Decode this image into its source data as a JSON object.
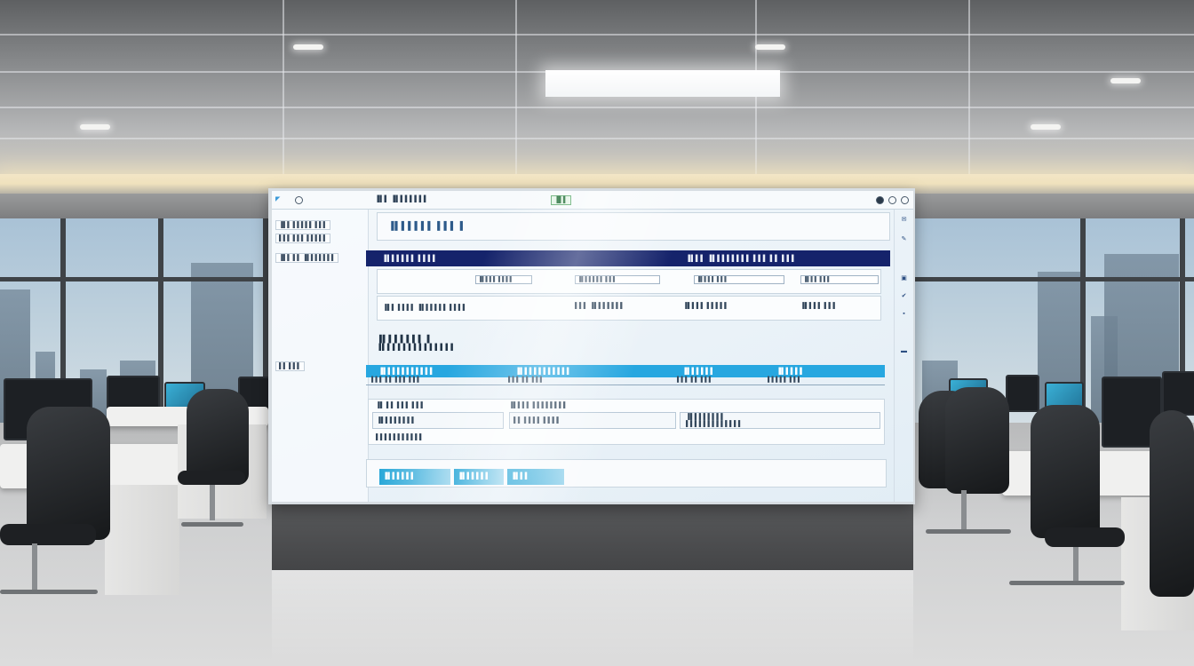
{
  "screen": {
    "topbar": {
      "title": "▐▌▌ ▐▌▌▌▌▌▌▌",
      "badge": "▐▌▌"
    },
    "sidebar": {
      "items": [
        "▐▌▌ ▌▌▌▌▌ ▌▌▌",
        "▌▌▌ ▌▌▌ ▌▌▌▌▌",
        "▐▌▌ ▌▌ ▐▌▌▌▌▌▌▌",
        "▌▌ ▌▌▌"
      ]
    },
    "main": {
      "title": "▐▌▌▌▌▌▌ ▌▌▌ ▌",
      "nav_left": "▐▌▌▌▌▌▌ ▌▌▌▌",
      "nav_right": "▐▌▌▌ ▐▌▌▌▌▌▌▌▌ ▌▌▌ ▌▌ ▌▌▌",
      "filters": [
        "▐▌▌▌▌ ▌▌▌▌",
        "▐▌▌▌▌▌▌ ▌▌▌",
        "▐▌▌▌▌ ▌▌▌",
        "▐▌▌▌ ▌▌▌"
      ],
      "summary": [
        "▐▌▌ ▌▌▌▌ ▐▌▌▌▌▌▌ ▌▌▌▌",
        "▌▌▌ ▐▌▌▌▌▌▌▌",
        "▐▌▌▌▌ ▌▌▌▌▌",
        "▐▌▌▌▌ ▌▌▌"
      ],
      "section_title": "▐▌▌▌▌▌▌▌ ▌",
      "section_subtitle": "▐▌▌▌▌▌▌▌▌▌▌▌▌▌▌",
      "table_headers": [
        "▐▌▌▌▌▌▌▌▌▌▌▌",
        "▐▌▌▌▌▌▌▌▌▌▌▌",
        "▐▌▌▌▌▌▌",
        "▐▌▌▌▌▌"
      ],
      "table_row": [
        "▌▌▌ ▌▌ ▌▌▌ ▌▌▌",
        "▌▌▌ ▌▌ ▌▌▌",
        "▌▌▌ ▌▌ ▌▌▌",
        "▌▌▌▌▌ ▌▌▌"
      ],
      "card_title": "▐▌ ▌▌ ▌▌▌ ▌▌▌",
      "card_items": [
        "▐▌▌▌▌ ▌▌▌▌▌▌▌▌",
        "▌▌ ▌▌▌▌ ▌▌▌▌",
        "▐▌▌▌▌▌▌▌▌"
      ],
      "card_sub": [
        "▐▌▌▌▌▌▌▌▌",
        "▌▌▌▌▌▌▌▌▌▌▌",
        "▌▌▌▌▌▌▌▌▌▌▌▌▌"
      ],
      "footer_tiles": [
        "▐▌▌▌▌▌▌",
        "▐▌▌▌▌▌▌",
        "▐▌▌▌"
      ]
    },
    "rail_icons": [
      "✉",
      "✎",
      "▣",
      "✔",
      "▪",
      "▬"
    ]
  },
  "colors": {
    "nav_bar": "#15236b",
    "table_header": "#27a7e0",
    "badge_green": "#5aa86b"
  }
}
